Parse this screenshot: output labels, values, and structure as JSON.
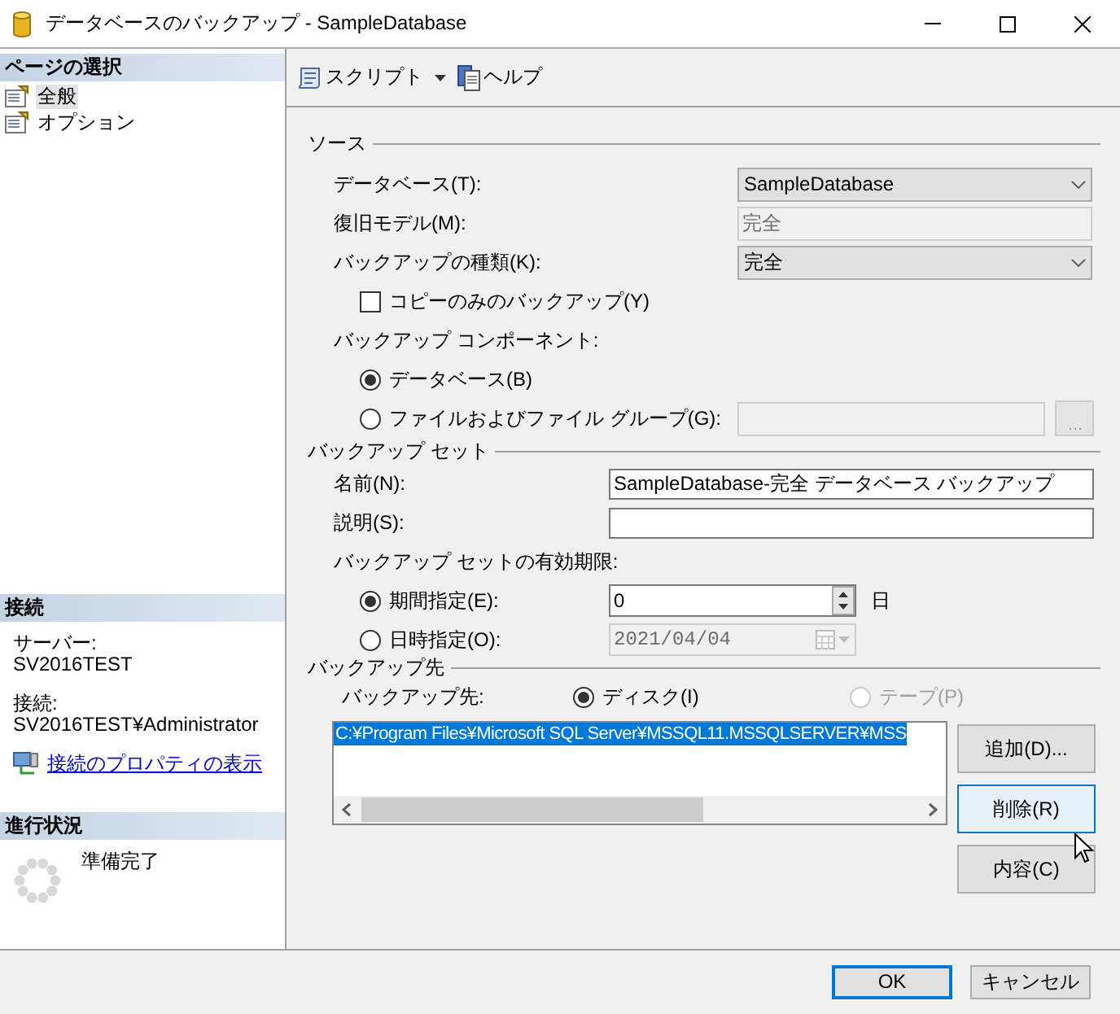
{
  "window": {
    "title": "データベースのバックアップ - SampleDatabase"
  },
  "sidebar": {
    "page_select": {
      "header": "ページの選択",
      "items": [
        {
          "label": "全般",
          "selected": true
        },
        {
          "label": "オプション",
          "selected": false
        }
      ]
    },
    "connection": {
      "header": "接続",
      "server_label": "サーバー:",
      "server": "SV2016TEST",
      "connection_label": "接続:",
      "connection": "SV2016TEST¥Administrator",
      "link": "接続のプロパティの表示"
    },
    "progress": {
      "header": "進行状況",
      "status": "準備完了"
    }
  },
  "toolbar": {
    "script": "スクリプト",
    "help": "ヘルプ"
  },
  "source": {
    "header": "ソース",
    "database": {
      "label": "データベース(T):",
      "value": "SampleDatabase"
    },
    "recovery_model": {
      "label": "復旧モデル(M):",
      "value": "完全",
      "disabled": true
    },
    "backup_type": {
      "label": "バックアップの種類(K):",
      "value": "完全"
    },
    "copy_only": {
      "label": "コピーのみのバックアップ(Y)",
      "checked": false
    },
    "component_label": "バックアップ コンポーネント:",
    "components": [
      {
        "label": "データベース(B)",
        "selected": true
      },
      {
        "label": "ファイルおよびファイル グループ(G):",
        "selected": false
      }
    ]
  },
  "backup_set": {
    "header": "バックアップ セット",
    "name": {
      "label": "名前(N):",
      "value": "SampleDatabase-完全 データベース バックアップ"
    },
    "description": {
      "label": "説明(S):"
    },
    "expiry_label": "バックアップ セットの有効期限:",
    "expiry_options": [
      {
        "label": "期間指定(E):",
        "selected": true,
        "value": "0",
        "unit": "日"
      },
      {
        "label": "日時指定(O):",
        "selected": false,
        "value": "2021/04/04"
      }
    ]
  },
  "destination": {
    "header": "バックアップ先",
    "label": "バックアップ先:",
    "media": [
      {
        "label": "ディスク(I)",
        "selected": true,
        "disabled": false
      },
      {
        "label": "テープ(P)",
        "selected": false,
        "disabled": true
      }
    ],
    "paths": [
      {
        "text": "C:¥Program Files¥Microsoft SQL Server¥MSSQL11.MSSQLSERVER¥MSS",
        "selected": true
      }
    ],
    "buttons": [
      {
        "label": "追加(D)...",
        "hovered": false
      },
      {
        "label": "削除(R)",
        "hovered": true
      },
      {
        "label": "内容(C)",
        "hovered": false
      }
    ]
  },
  "footer": {
    "buttons": [
      {
        "label": "OK",
        "default": true
      },
      {
        "label": "キャンセル",
        "default": false
      }
    ]
  }
}
